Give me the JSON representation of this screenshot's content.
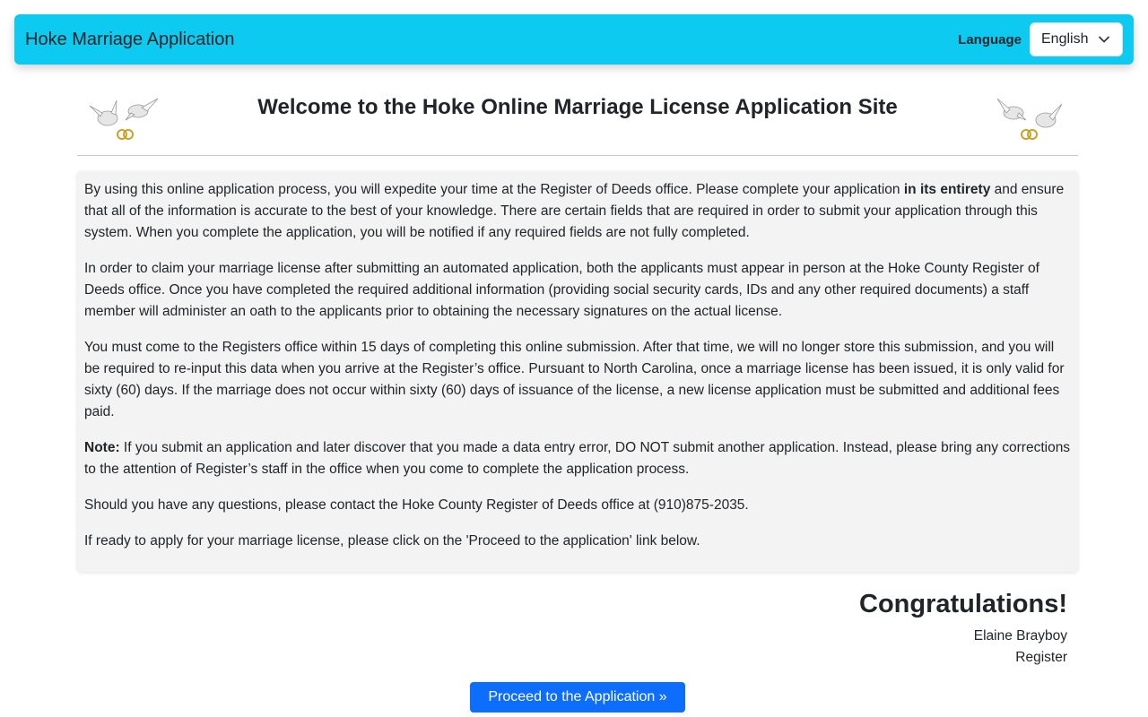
{
  "navbar": {
    "brand": "Hoke Marriage Application",
    "language_label": "Language",
    "language_value": "English"
  },
  "header": {
    "title": "Welcome to the Hoke Online Marriage License Application Site"
  },
  "info": {
    "p1_before": "By using this online application process, you will expedite your time at the Register of Deeds office. Please complete your application ",
    "p1_bold": "in its entirety",
    "p1_after": " and ensure that all of the information is accurate to the best of your knowledge. There are certain fields that are required in order to submit your application through this system. When you complete the application, you will be notified if any required fields are not fully completed.",
    "p2": "In order to claim your marriage license after submitting an automated application, both the applicants must appear in person at the Hoke County Register of Deeds office. Once you have completed the required additional information (providing social security cards, IDs and any other required documents) a staff member will administer an oath to the applicants prior to obtaining the necessary signatures on the actual license.",
    "p3": "You must come to the Registers office within 15 days of completing this online submission. After that time, we will no longer store this submission, and you will be required to re-input this data when you arrive at the Register’s office. Pursuant to North Carolina, once a marriage license has been issued, it is only valid for sixty (60) days. If the marriage does not occur within sixty (60) days of issuance of the license, a new license application must be submitted and additional fees paid.",
    "p4_bold": "Note:",
    "p4_after": " If you submit an application and later discover that you made a data entry error, DO NOT submit another application. Instead, please bring any corrections to the attention of Register’s staff in the office when you come to complete the application process.",
    "p5": "Should you have any questions, please contact the Hoke County Register of Deeds office at (910)875-2035.",
    "p6": "If ready to apply for your marriage license, please click on the 'Proceed to the application' link below."
  },
  "signature": {
    "congrats": "Congratulations!",
    "name": "Elaine Brayboy",
    "role": "Register"
  },
  "actions": {
    "proceed_label": "Proceed to the Application  »"
  },
  "icons": {
    "left": "doves-rings-icon",
    "right": "doves-rings-icon",
    "dropdown": "chevron-down-icon"
  },
  "colors": {
    "navbar_bg": "#0dcaf0",
    "button_bg": "#0d6efd",
    "info_bg": "#f3f3f3"
  }
}
